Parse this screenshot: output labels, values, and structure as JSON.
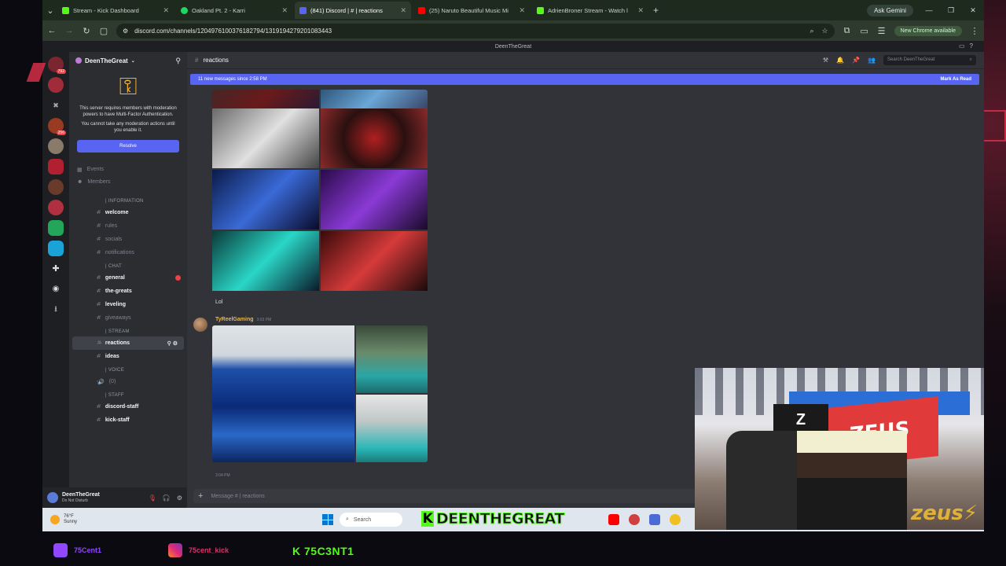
{
  "browser": {
    "tabs": [
      {
        "title": "Stream - Kick Dashboard",
        "color": "#53fc18",
        "active": false
      },
      {
        "title": "Oakland Pt. 2 - Karri",
        "color": "#1ed760",
        "active": false
      },
      {
        "title": "(841) Discord | # | reactions",
        "color": "#5865f2",
        "active": true
      },
      {
        "title": "(25) Naruto Beautiful Music Mi",
        "color": "#ff0000",
        "active": false
      },
      {
        "title": "AdrienBroner Stream - Watch l",
        "color": "#53fc18",
        "active": false
      }
    ],
    "new_tab": "+",
    "ask_gemini": "Ask Gemini",
    "url": "discord.com/channels/1204976100376182794/1319194279201083443",
    "new_chrome": "New Chrome available"
  },
  "window_title": "DeenTheGreat",
  "server": {
    "name": "DeenTheGreat",
    "mfa_text": "This server requires members with moderation powers to have Multi-Factor Authentication.",
    "mfa_text2": "You cannot take any moderation actions until you enable it.",
    "mfa_button": "Resolve",
    "links": [
      {
        "icon": "calendar-icon",
        "label": "Events"
      },
      {
        "icon": "members-icon",
        "label": "Members"
      }
    ],
    "categories": [
      {
        "name": "| INFORMATION",
        "channels": [
          {
            "label": "welcome",
            "muted": false
          },
          {
            "label": "rules",
            "muted": true
          },
          {
            "label": "socials",
            "muted": true
          },
          {
            "label": "notifications",
            "muted": true
          }
        ]
      },
      {
        "name": "| CHAT",
        "channels": [
          {
            "label": "general",
            "muted": false,
            "unread": true
          },
          {
            "label": "the-greats",
            "muted": false
          },
          {
            "label": "leveling",
            "muted": false
          },
          {
            "label": "giveaways",
            "muted": true
          }
        ]
      },
      {
        "name": "| STREAM",
        "channels": [
          {
            "label": "reactions",
            "muted": false,
            "active": true
          },
          {
            "label": "ideas",
            "muted": false
          }
        ]
      },
      {
        "name": "| VOICE",
        "channels": [
          {
            "label": "(0)",
            "muted": true,
            "voice": true
          }
        ]
      },
      {
        "name": "| STAFF",
        "channels": [
          {
            "label": "discord-staff",
            "muted": false
          },
          {
            "label": "kick-staff",
            "muted": false
          }
        ]
      }
    ]
  },
  "user": {
    "name": "DeenTheGreat",
    "status": "Do Not Disturb"
  },
  "channel": {
    "name": "reactions",
    "search_placeholder": "Search DeenTheGreat",
    "new_messages": "11 new messages since 2:58 PM",
    "mark_read": "Mark As Read",
    "caption": "Lol",
    "message_author": "TyReelGaming",
    "message_time": "3:03 PM",
    "next_author_time": "3:04 PM",
    "composer_placeholder": "Message # | reactions"
  },
  "taskbar": {
    "temp": "76°F",
    "condition": "Sunny",
    "search": "Search"
  },
  "overlay": {
    "kick_banner": "DEENTHEGREAT",
    "kick_letter": "K",
    "twitch_handle": "75Cent1",
    "instagram_handle": "75cent_kick",
    "kick_handle": "K 75C3NT1",
    "webcam_brand": "ZEUS",
    "webcam_corner": "zeus"
  }
}
